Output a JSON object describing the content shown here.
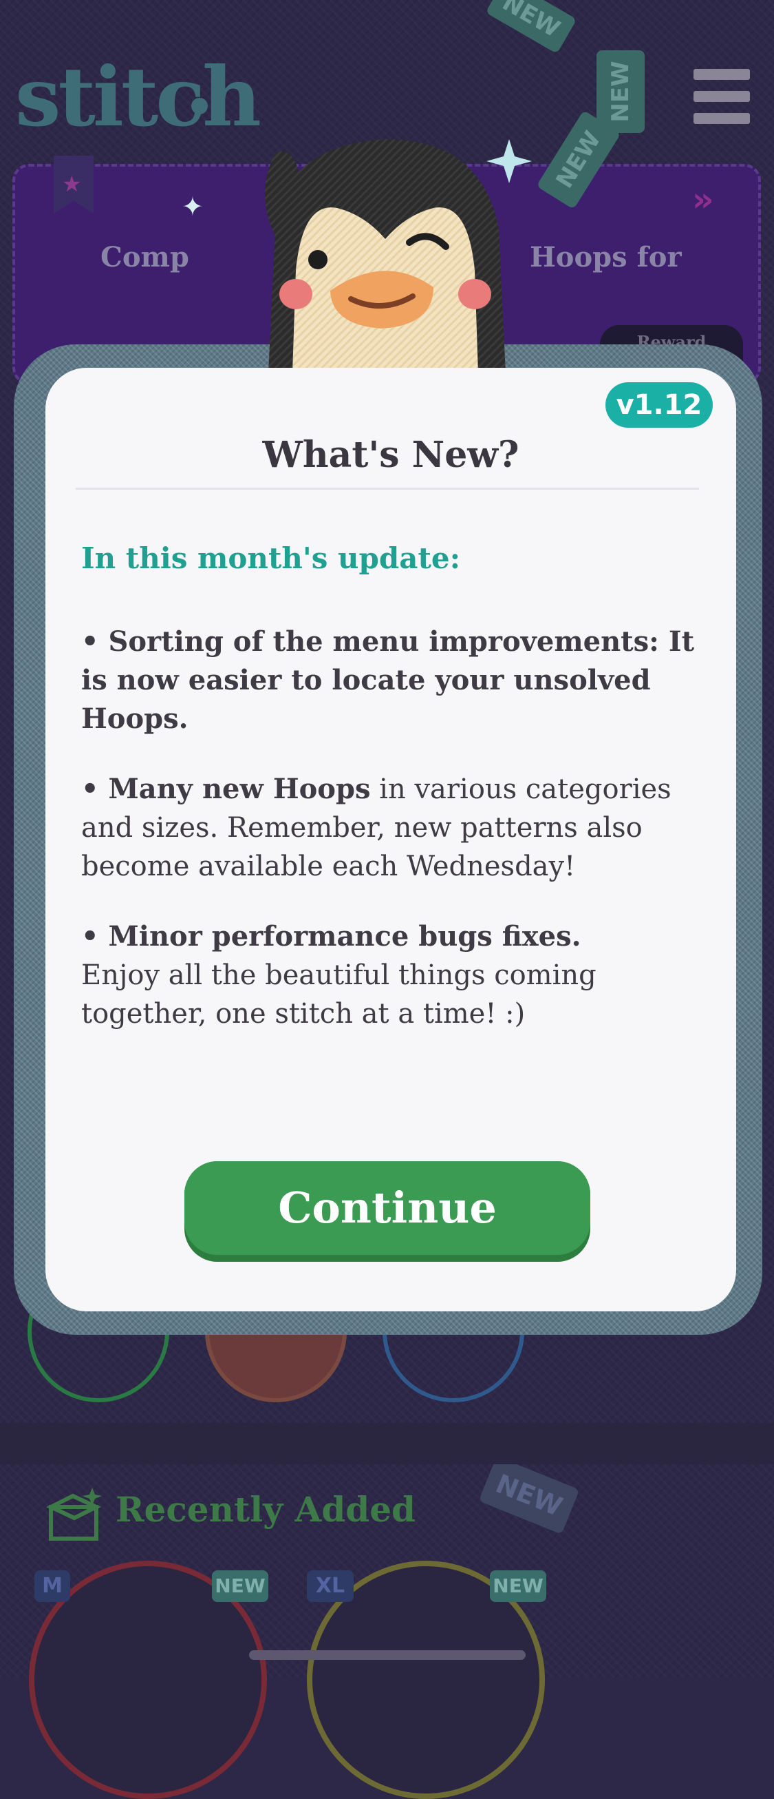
{
  "app": {
    "logo_text": "stitch"
  },
  "banner": {
    "text_left": "Comp",
    "text_right": "Hoops for",
    "reward_label": "Reward"
  },
  "new_tags": [
    "NEW",
    "NEW",
    "NEW",
    "NEW",
    "NEW",
    "NEW"
  ],
  "modal": {
    "version": "v1.12",
    "title": "What's New?",
    "update_heading": "In this month's update:",
    "notes": [
      {
        "bold": "• Sorting of the menu improvements: It is now easier to locate your unsolved Hoops.",
        "rest": ""
      },
      {
        "bold": "• Many new Hoops",
        "rest": " in various categories and sizes. Remember, new patterns also become available each Wednesday!"
      },
      {
        "bold": "• Minor performance bugs fixes.",
        "rest": "Enjoy all the beautiful things coming together, one stitch at a time! :)"
      }
    ],
    "continue_label": "Continue"
  },
  "recent": {
    "title": "Recently Added",
    "items": [
      {
        "size": "M",
        "badge": "NEW"
      },
      {
        "size": "XL",
        "badge": "NEW"
      }
    ]
  },
  "colors": {
    "accent_teal": "#1fa090",
    "button_green": "#3b9b52",
    "background": "#2d2748"
  }
}
